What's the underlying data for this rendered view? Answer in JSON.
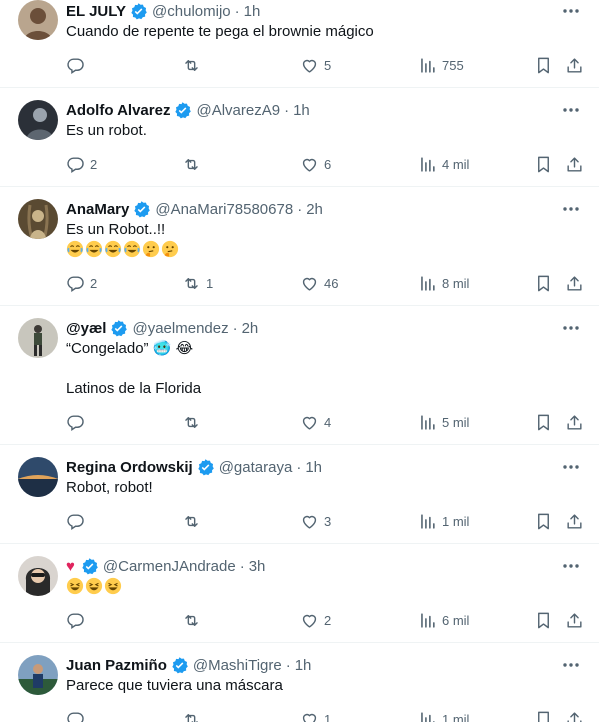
{
  "tweets": [
    {
      "name": "EL JULY",
      "verified": true,
      "handle": "@chulomijo",
      "time": "1h",
      "lines": [
        "Cuando de repente te pega el brownie mágico"
      ],
      "emoji_line": [],
      "stats": {
        "replies": "",
        "reposts": "",
        "likes": "5",
        "views": "755"
      },
      "avatar": {
        "bg": "#b9a58e",
        "fg": "#6b4f3a"
      }
    },
    {
      "name": "Adolfo Alvarez",
      "verified": true,
      "handle": "@AlvarezA9",
      "time": "1h",
      "lines": [
        "Es un robot."
      ],
      "emoji_line": [],
      "stats": {
        "replies": "2",
        "reposts": "",
        "likes": "6",
        "views": "4 mil"
      },
      "avatar": {
        "bg": "#2b3038",
        "fg": "#9aa3ad"
      }
    },
    {
      "name": "AnaMary",
      "verified": true,
      "handle": "@AnaMari78580678",
      "time": "2h",
      "lines": [
        "Es un Robot..!!"
      ],
      "emoji_line": [
        "joy",
        "joy",
        "joy",
        "joy",
        "thinking",
        "thinking"
      ],
      "stats": {
        "replies": "2",
        "reposts": "1",
        "likes": "46",
        "views": "8 mil"
      },
      "avatar": {
        "bg": "#5a4a32",
        "fg": "#c9b48a"
      }
    },
    {
      "name": "@yæl",
      "verified": true,
      "handle": "@yaelmendez",
      "time": "2h",
      "lines": [
        "“Congelado” 🥶 😂",
        "",
        "Latinos de la Florida"
      ],
      "emoji_line": [],
      "stats": {
        "replies": "",
        "reposts": "",
        "likes": "4",
        "views": "5 mil"
      },
      "avatar": {
        "bg": "#c8c6bd",
        "fg": "#3d4a3a"
      }
    },
    {
      "name": "Regina Ordowskij",
      "verified": true,
      "handle": "@gataraya",
      "time": "1h",
      "lines": [
        "Robot, robot!"
      ],
      "emoji_line": [],
      "stats": {
        "replies": "",
        "reposts": "",
        "likes": "3",
        "views": "1 mil"
      },
      "avatar": {
        "bg": "#2f4a6b",
        "fg": "#e0a35a"
      }
    },
    {
      "name": "♥",
      "verified": true,
      "handle": "@CarmenJAndrade",
      "time": "3h",
      "lines": [],
      "emoji_line": [
        "laugh",
        "laugh",
        "laugh"
      ],
      "stats": {
        "replies": "",
        "reposts": "",
        "likes": "2",
        "views": "6 mil"
      },
      "avatar": {
        "bg": "#d9d4cf",
        "fg": "#2a2a2a"
      }
    },
    {
      "name": "Juan Pazmiño",
      "verified": true,
      "handle": "@MashiTigre",
      "time": "1h",
      "lines": [
        "Parece que tuviera una máscara"
      ],
      "emoji_line": [],
      "stats": {
        "replies": "",
        "reposts": "",
        "likes": "1",
        "views": "1 mil"
      },
      "avatar": {
        "bg": "#7fa0c0",
        "fg": "#2d5a3a"
      }
    }
  ],
  "colors": {
    "text": "#0f1419",
    "secondary": "#536471",
    "verified": "#1d9bf0",
    "divider": "#eff3f4",
    "emoji": "#ffcc4d"
  },
  "icons": [
    "reply-icon",
    "repost-icon",
    "like-icon",
    "views-icon",
    "bookmark-icon",
    "share-icon",
    "more-icon",
    "verified-badge-icon"
  ]
}
